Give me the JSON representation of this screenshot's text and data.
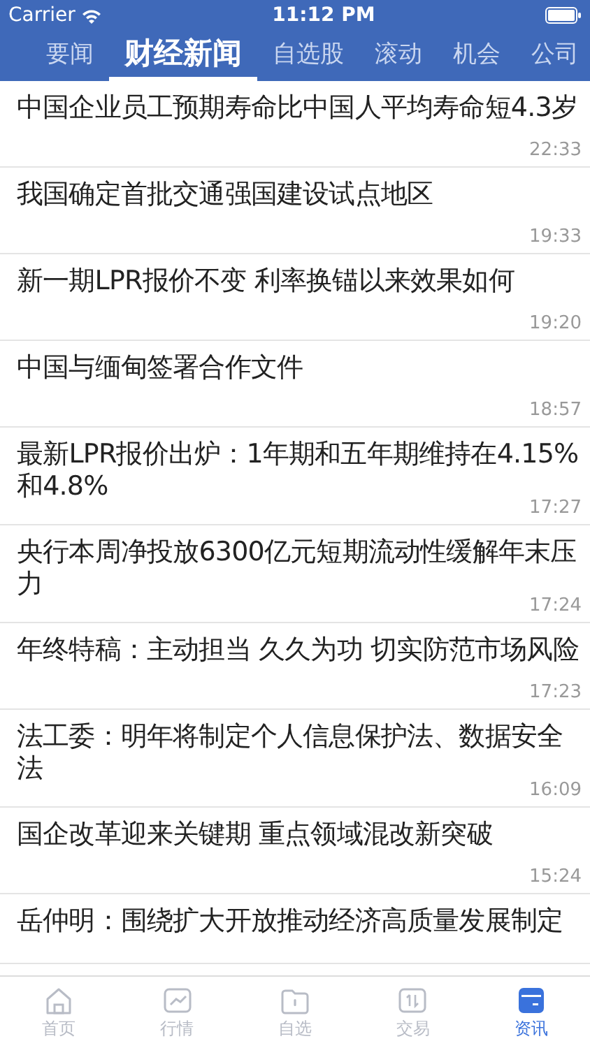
{
  "status_bar": {
    "carrier": "Carrier",
    "time": "11:12 PM"
  },
  "tabs": [
    {
      "label": "要闻",
      "selected": false
    },
    {
      "label": "财经新闻",
      "selected": true
    },
    {
      "label": "自选股",
      "selected": false
    },
    {
      "label": "滚动",
      "selected": false
    },
    {
      "label": "机会",
      "selected": false
    },
    {
      "label": "公司",
      "selected": false
    }
  ],
  "news": [
    {
      "title": "中国企业员工预期寿命比中国人平均寿命短4.3岁",
      "time": "22:33"
    },
    {
      "title": "我国确定首批交通强国建设试点地区",
      "time": "19:33"
    },
    {
      "title": "新一期LPR报价不变 利率换锚以来效果如何",
      "time": "19:20"
    },
    {
      "title": "中国与缅甸签署合作文件",
      "time": "18:57"
    },
    {
      "title": "最新LPR报价出炉：1年期和五年期维持在4.15%和4.8%",
      "time": "17:27"
    },
    {
      "title": "央行本周净投放6300亿元短期流动性缓解年末压力",
      "time": "17:24"
    },
    {
      "title": "年终特稿：主动担当 久久为功 切实防范市场风险",
      "time": "17:23"
    },
    {
      "title": "法工委：明年将制定个人信息保护法、数据安全法",
      "time": "16:09"
    },
    {
      "title": "国企改革迎来关键期 重点领域混改新突破",
      "time": "15:24"
    },
    {
      "title": "岳仲明：围绕扩大开放推动经济高质量发展制定"
    }
  ],
  "tab_bar": [
    {
      "kind": "home",
      "label": "首页",
      "selected": false
    },
    {
      "kind": "chart",
      "label": "行情",
      "selected": false
    },
    {
      "kind": "folder",
      "label": "自选",
      "selected": false
    },
    {
      "kind": "trade",
      "label": "交易",
      "selected": false
    },
    {
      "kind": "news",
      "label": "资讯",
      "selected": true
    }
  ]
}
